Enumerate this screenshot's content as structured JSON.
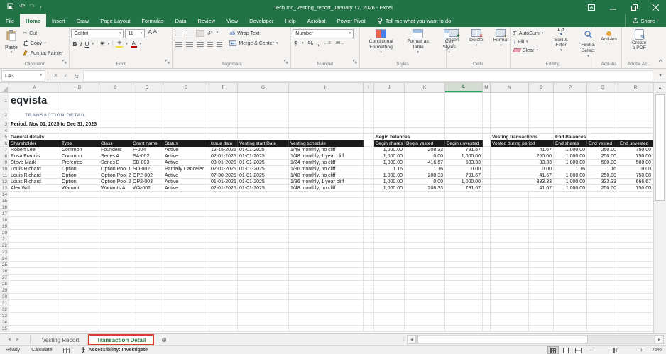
{
  "icons": {
    "caret": "▾",
    "dropdown_small": "▾"
  },
  "titlebar": {
    "title": "Tech Inc_Vesting_report_January 17, 2026  -  Excel"
  },
  "menu": {
    "tabs": [
      "File",
      "Home",
      "Insert",
      "Draw",
      "Page Layout",
      "Formulas",
      "Data",
      "Review",
      "View",
      "Developer",
      "Help",
      "Acrobat",
      "Power Pivot"
    ],
    "active_tab": "Home",
    "tell_me": "Tell me what you want to do",
    "share": "Share"
  },
  "ribbon": {
    "clipboard": {
      "label": "Clipboard",
      "paste": "Paste",
      "cut": "Cut",
      "copy": "Copy",
      "format_painter": "Format Painter"
    },
    "font": {
      "label": "Font",
      "family": "Calibri",
      "size": "11",
      "bold": "B",
      "italic": "I",
      "underline": "U",
      "grow": "A",
      "shrink": "A",
      "color_letter": "A"
    },
    "alignment": {
      "label": "Alignment",
      "wrap": "Wrap Text",
      "merge": "Merge & Center",
      "orient": "ab"
    },
    "number": {
      "label": "Number",
      "format": "Number",
      "dollar": "$",
      "percent": "%",
      "comma": ",",
      "inc_dec": "←.0",
      "dec_dec": ".00→"
    },
    "styles": {
      "label": "Styles",
      "conditional": "Conditional Formatting",
      "format_table": "Format as Table",
      "cell_styles": "Cell Styles"
    },
    "cells": {
      "label": "Cells",
      "insert": "Insert",
      "delete": "Delete",
      "format": "Format"
    },
    "editing": {
      "label": "Editing",
      "autosum_sigma": "Σ",
      "autosum": "AutoSum",
      "fill": "Fill",
      "clear": "Clear",
      "sort": "Sort & Filter",
      "find": "Find & Select",
      "az": "A↓Z"
    },
    "addins": {
      "label": "Add-ins",
      "button": "Add-ins"
    },
    "adobe": {
      "label": "Adobe Ac...",
      "create_pdf_1": "Create",
      "create_pdf_2": "a PDF"
    }
  },
  "formula_bar": {
    "name_box": "L43",
    "cancel": "✕",
    "enter": "✓",
    "fx": "fx"
  },
  "grid": {
    "columns": [
      "A",
      "B",
      "C",
      "D",
      "E",
      "F",
      "G",
      "H",
      "I",
      "J",
      "K",
      "L",
      "M",
      "N",
      "O",
      "P",
      "Q",
      "R"
    ],
    "selected_column": "L",
    "logo": "eqvista",
    "subtitle": "TRANSACTION DETAIL",
    "period": "Period: Nov 01, 2025 to Dec 31, 2025",
    "groups": {
      "general": "General details",
      "begin": "Begin balances",
      "vesting": "Vesting transactions",
      "end": "End Balances"
    },
    "headers": [
      "Shareholder",
      "Type",
      "Class",
      "Grant name",
      "Status",
      "Issue date",
      "Vesting start Date",
      "Vesting schedule",
      "Begin shares",
      "Begin vested",
      "Begin unvested",
      "Vested during period",
      "End shares",
      "End vested",
      "End unvested"
    ],
    "rows": [
      [
        "Robert Lee",
        "Common",
        "Founders",
        "F-004",
        "Active",
        "12-15-2025",
        "01-01-2025",
        "1/48 monthly, no cliff",
        "1,000.00",
        "208.33",
        "791.67",
        "41.67",
        "1,000.00",
        "250.00",
        "750.00"
      ],
      [
        "Rosa Francis",
        "Common",
        "Series A",
        "SA-002",
        "Active",
        "02-01-2025",
        "01-01-2025",
        "1/48 monthly, 1 year cliff",
        "1,000.00",
        "0.00",
        "1,000.00",
        "250.00",
        "1,000.00",
        "250.00",
        "750.00"
      ],
      [
        "Steve Mark",
        "Preferred",
        "Series B",
        "SB-003",
        "Active",
        "03-01-2025",
        "01-01-2025",
        "1/24 monthly, no cliff",
        "1,000.00",
        "416.67",
        "583.33",
        "83.33",
        "1,000.00",
        "500.00",
        "500.00"
      ],
      [
        "Louis Richard",
        "Option",
        "Option Pool 1",
        "SO-002",
        "Partially Canceled",
        "02-01-2025",
        "01-01-2025",
        "1/36 monthly, no cliff",
        "1.16",
        "1.16",
        "0.00",
        "0.00",
        "1.16",
        "1.16",
        "0.00"
      ],
      [
        "Louis Richard",
        "Option",
        "Option Pool 2",
        "OP2-002",
        "Active",
        "07-30-2025",
        "01-01-2025",
        "1/48 monthly, no cliff",
        "1,000.00",
        "208.33",
        "791.67",
        "41.67",
        "1,000.00",
        "250.00",
        "750.00"
      ],
      [
        "Louis Richard",
        "Option",
        "Option Pool 2",
        "OP2-003",
        "Active",
        "01-01-2026",
        "01-01-2025",
        "1/36 monthly, 1 year cliff",
        "1,000.00",
        "0.00",
        "1,000.00",
        "333.33",
        "1,000.00",
        "333.33",
        "666.67"
      ],
      [
        "Alex Will",
        "Warrant",
        "Warrants A",
        "WA-002",
        "Active",
        "02-01-2025",
        "01-01-2025",
        "1/48 monthly, no cliff",
        "1,000.00",
        "208.33",
        "791.67",
        "41.67",
        "1,000.00",
        "250.00",
        "750.00"
      ]
    ]
  },
  "sheet_tabs": {
    "tabs": [
      "Vesting Report",
      "Transaction Detail"
    ],
    "active": "Transaction Detail"
  },
  "status_bar": {
    "ready": "Ready",
    "calculate": "Calculate",
    "accessibility": "Accessibility: Investigate",
    "zoom": "75%"
  }
}
